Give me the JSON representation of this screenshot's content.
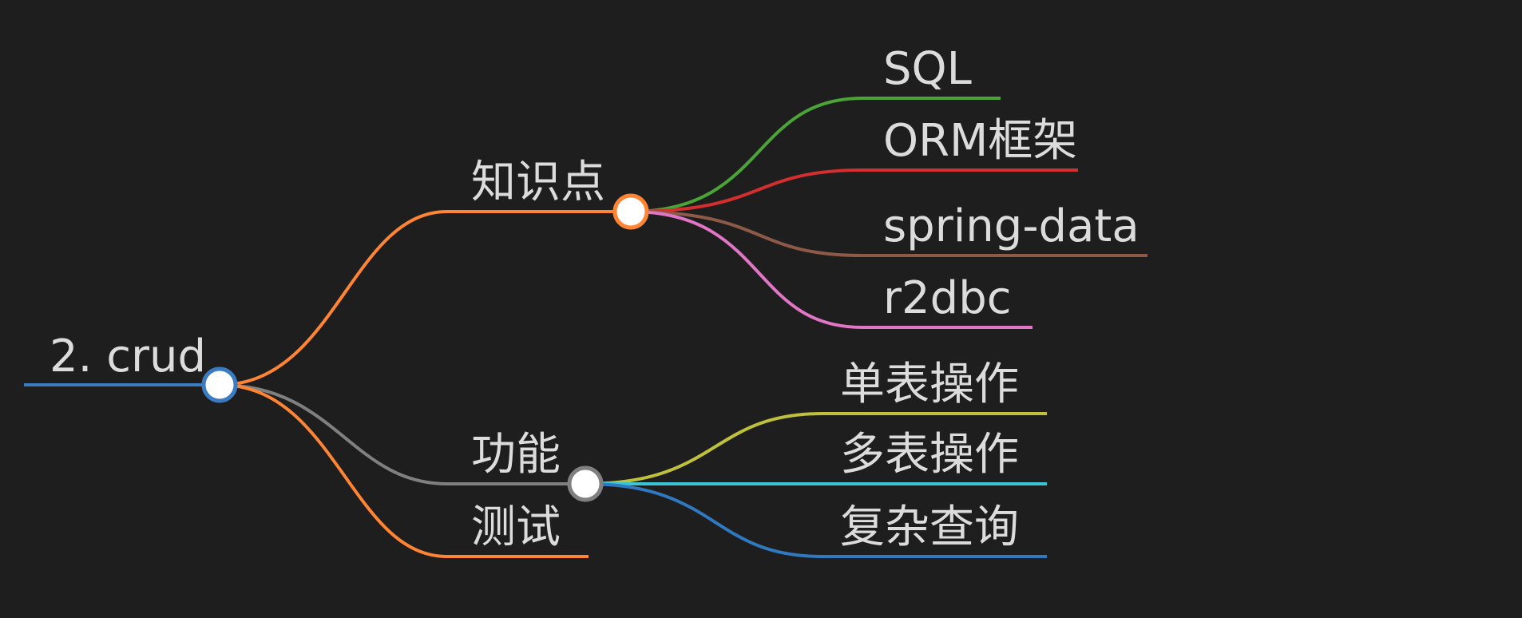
{
  "background": "#1e1e1e",
  "root": {
    "label": "2. crud",
    "color": "#3a7cc2",
    "children": [
      {
        "label": "知识点",
        "color": "#ff8534",
        "children": [
          {
            "label": "SQL",
            "color": "#4aa436"
          },
          {
            "label": "ORM框架",
            "color": "#d42e2e"
          },
          {
            "label": "spring-data",
            "color": "#8e5a48"
          },
          {
            "label": "r2dbc",
            "color": "#e276c6"
          }
        ]
      },
      {
        "label": "功能",
        "color": "#808080",
        "children": [
          {
            "label": "单表操作",
            "color": "#bfc13a"
          },
          {
            "label": "多表操作",
            "color": "#3bc3d6"
          },
          {
            "label": "复杂查询",
            "color": "#2e79c0"
          }
        ]
      },
      {
        "label": "测试",
        "color": "#ff8534",
        "children": []
      }
    ]
  }
}
